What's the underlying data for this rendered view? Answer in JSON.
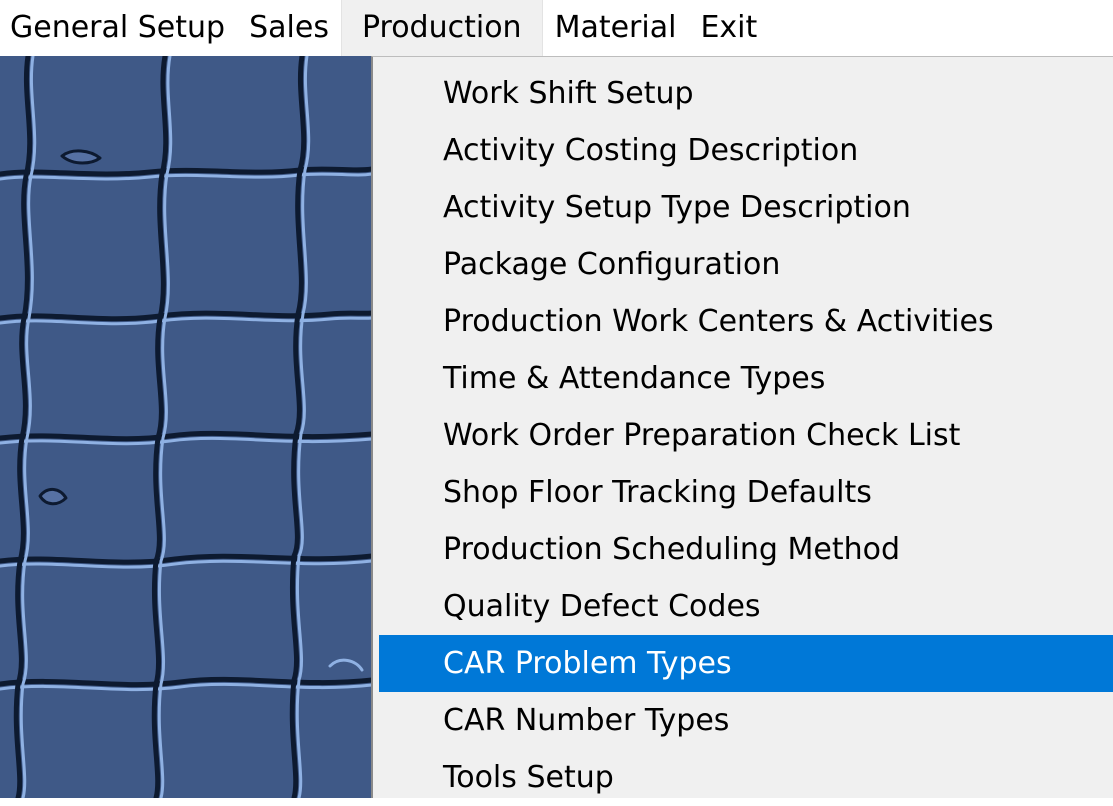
{
  "menubar": {
    "items": [
      {
        "label": "General Setup"
      },
      {
        "label": "Sales"
      },
      {
        "label": "Production"
      },
      {
        "label": "Material"
      },
      {
        "label": "Exit"
      }
    ]
  },
  "production_menu": {
    "items": [
      {
        "label": "Work Shift Setup"
      },
      {
        "label": "Activity Costing Description"
      },
      {
        "label": "Activity Setup Type Description"
      },
      {
        "label": "Package Configuration"
      },
      {
        "label": "Production Work Centers & Activities"
      },
      {
        "label": "Time & Attendance Types"
      },
      {
        "label": "Work Order Preparation Check List"
      },
      {
        "label": "Shop Floor Tracking Defaults"
      },
      {
        "label": "Production Scheduling Method"
      },
      {
        "label": "Quality Defect Codes"
      },
      {
        "label": "CAR Problem Types",
        "selected": true
      },
      {
        "label": "CAR Number Types"
      },
      {
        "label": "Tools Setup"
      }
    ]
  },
  "colors": {
    "desktop": "#3f5987",
    "menu_bg": "#f0f0f0",
    "highlight": "#0078d7"
  }
}
